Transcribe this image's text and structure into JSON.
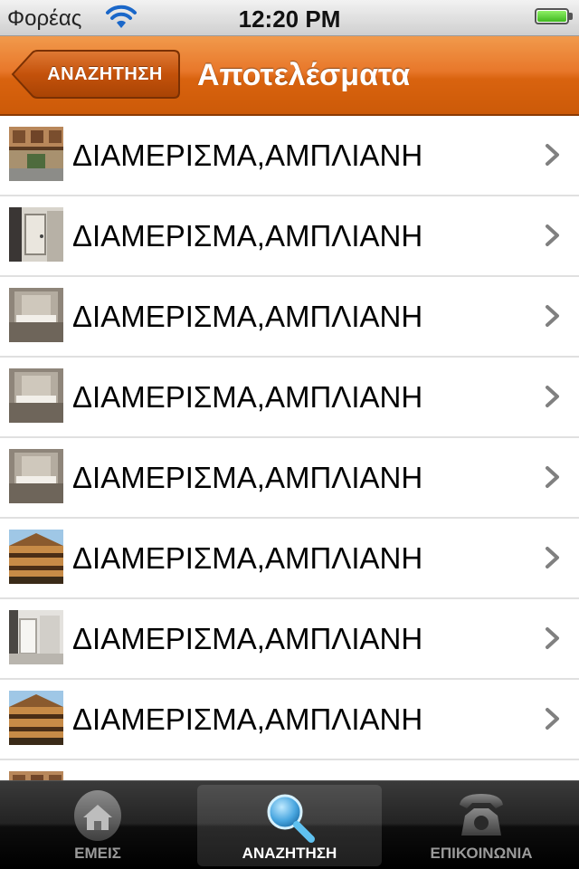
{
  "status_bar": {
    "carrier": "Φορέας",
    "time": "12:20 PM",
    "battery_level": 1.0
  },
  "nav": {
    "back_label": "ΑΝΑΖΗΤΗΣΗ",
    "title": "Αποτελέσματα"
  },
  "results": [
    {
      "label": "ΔΙΑΜΕΡΙΣΜΑ,ΑΜΠΛΙΑΝΗ",
      "thumb": "building"
    },
    {
      "label": "ΔΙΑΜΕΡΙΣΜΑ,ΑΜΠΛΙΑΝΗ",
      "thumb": "door"
    },
    {
      "label": "ΔΙΑΜΕΡΙΣΜΑ,ΑΜΠΛΙΑΝΗ",
      "thumb": "room"
    },
    {
      "label": "ΔΙΑΜΕΡΙΣΜΑ,ΑΜΠΛΙΑΝΗ",
      "thumb": "room"
    },
    {
      "label": "ΔΙΑΜΕΡΙΣΜΑ,ΑΜΠΛΙΑΝΗ",
      "thumb": "room"
    },
    {
      "label": "ΔΙΑΜΕΡΙΣΜΑ,ΑΜΠΛΙΑΝΗ",
      "thumb": "balcony"
    },
    {
      "label": "ΔΙΑΜΕΡΙΣΜΑ,ΑΜΠΛΙΑΝΗ",
      "thumb": "hall"
    },
    {
      "label": "ΔΙΑΜΕΡΙΣΜΑ,ΑΜΠΛΙΑΝΗ",
      "thumb": "balcony"
    },
    {
      "label": "",
      "thumb": "building"
    }
  ],
  "tabs": [
    {
      "label": "ΕΜΕΙΣ",
      "icon": "house-icon",
      "selected": false
    },
    {
      "label": "ΑΝΑΖΗΤΗΣΗ",
      "icon": "magnifier-icon",
      "selected": true
    },
    {
      "label": "ΕΠΙΚΟΙΝΩΝΙΑ",
      "icon": "phone-icon",
      "selected": false
    }
  ],
  "colors": {
    "nav_orange": "#e8772a",
    "tab_bar": "#1a1a1a",
    "chevron": "#808080"
  }
}
